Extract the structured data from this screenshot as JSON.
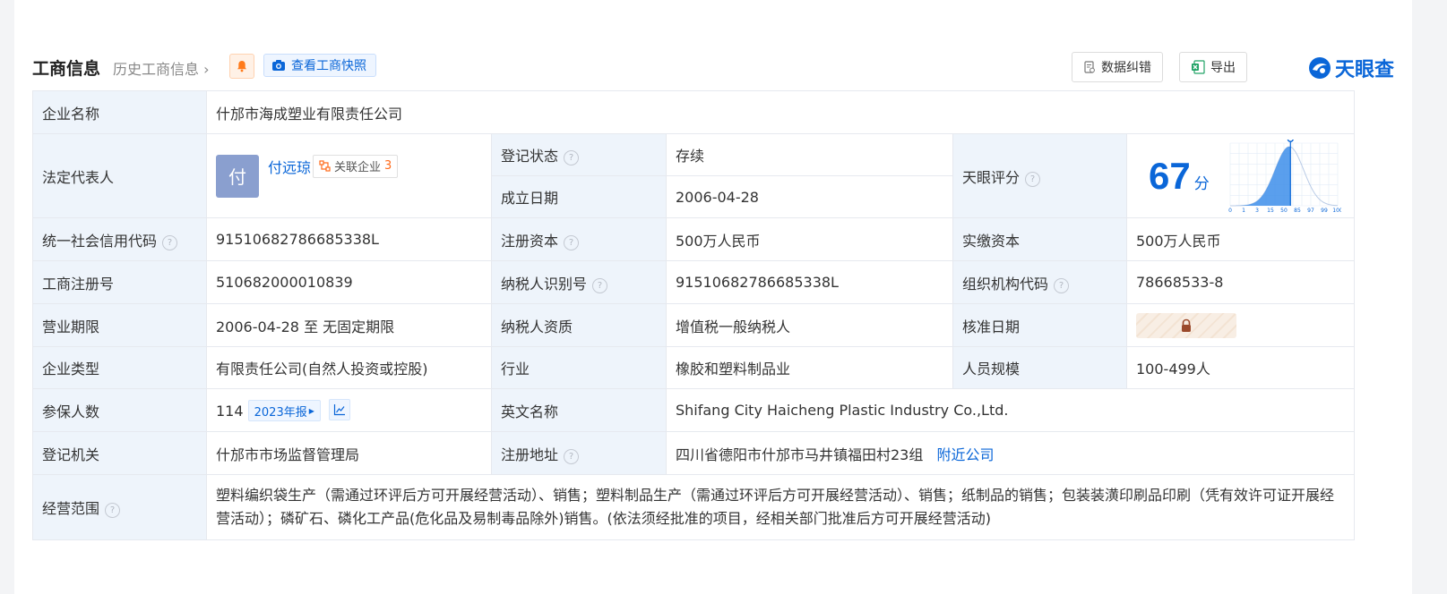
{
  "header": {
    "title": "工商信息",
    "history_link": "历史工商信息",
    "snapshot_button": "查看工商快照",
    "correction_button": "数据纠错",
    "export_button": "导出",
    "brand": "天眼查"
  },
  "colors": {
    "accent": "#0a66d8",
    "label_bg": "#eef4fb",
    "status_green": "#1f9a4b",
    "alert_orange": "#ff6a1a"
  },
  "company": {
    "name_label": "企业名称",
    "name": "什邡市海成塑业有限责任公司",
    "legal_rep_label": "法定代表人",
    "legal_rep_avatar": "付",
    "legal_rep_name": "付远琼",
    "related_label": "关联企业",
    "related_count": "3",
    "status_label": "登记状态",
    "status": "存续",
    "founded_label": "成立日期",
    "founded": "2006-04-28",
    "score_label": "天眼评分",
    "score": "67",
    "score_unit": "分",
    "score_axis": [
      "0",
      "1",
      "3",
      "15",
      "50",
      "85",
      "97",
      "99",
      "100"
    ],
    "credit_code_label": "统一社会信用代码",
    "credit_code": "91510682786685338L",
    "reg_capital_label": "注册资本",
    "reg_capital": "500万人民币",
    "paid_capital_label": "实缴资本",
    "paid_capital": "500万人民币",
    "reg_no_label": "工商注册号",
    "reg_no": "510682000010839",
    "taxpayer_id_label": "纳税人识别号",
    "taxpayer_id": "91510682786685338L",
    "org_code_label": "组织机构代码",
    "org_code": "78668533-8",
    "term_label": "营业期限",
    "term": "2006-04-28 至 无固定期限",
    "tax_qual_label": "纳税人资质",
    "tax_qual": "增值税一般纳税人",
    "approve_date_label": "核准日期",
    "type_label": "企业类型",
    "type": "有限责任公司(自然人投资或控股)",
    "industry_label": "行业",
    "industry": "橡胶和塑料制品业",
    "staff_label": "人员规模",
    "staff": "100-499人",
    "insured_label": "参保人数",
    "insured": "114",
    "report_badge": "2023年报",
    "en_name_label": "英文名称",
    "en_name": "Shifang City Haicheng Plastic Industry Co.,Ltd.",
    "authority_label": "登记机关",
    "authority": "什邡市市场监督管理局",
    "address_label": "注册地址",
    "address": "四川省德阳市什邡市马井镇福田村23组",
    "nearby_link": "附近公司",
    "scope_label": "经营范围",
    "scope": "塑料编织袋生产（需通过环评后方可开展经营活动）、销售；塑料制品生产（需通过环评后方可开展经营活动）、销售；纸制品的销售；包装装潢印刷品印刷（凭有效许可证开展经营活动）；磷矿石、磷化工产品(危化品及易制毒品除外)销售。(依法须经批准的项目，经相关部门批准后方可开展经营活动)"
  }
}
